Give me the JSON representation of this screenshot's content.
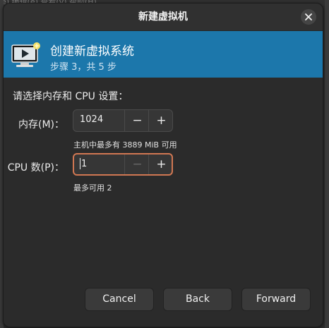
{
  "background": {
    "menubar_text": "e)    编辑(e)    查看(v)    帮助(H)"
  },
  "window": {
    "title": "新建虚拟机"
  },
  "banner": {
    "title": "创建新虚拟系统",
    "subtitle": "步骤 3，共 5 步",
    "accent_color": "#1c77ab"
  },
  "form": {
    "intro": "请选择内存和 CPU 设置：",
    "memory": {
      "label": "内存(M)：",
      "value": "1024",
      "decrement": "−",
      "increment": "+",
      "hint": "主机中最多有 3889 MiB 可用"
    },
    "cpu": {
      "label": "CPU 数(P)：",
      "value": "1",
      "decrement": "−",
      "increment": "+",
      "hint": "最多可用 2",
      "focus_color": "#d07752"
    }
  },
  "buttons": {
    "cancel": "Cancel",
    "back": "Back",
    "forward": "Forward"
  },
  "icons": {
    "close": "close-icon",
    "banner": "monitor-play-icon"
  }
}
